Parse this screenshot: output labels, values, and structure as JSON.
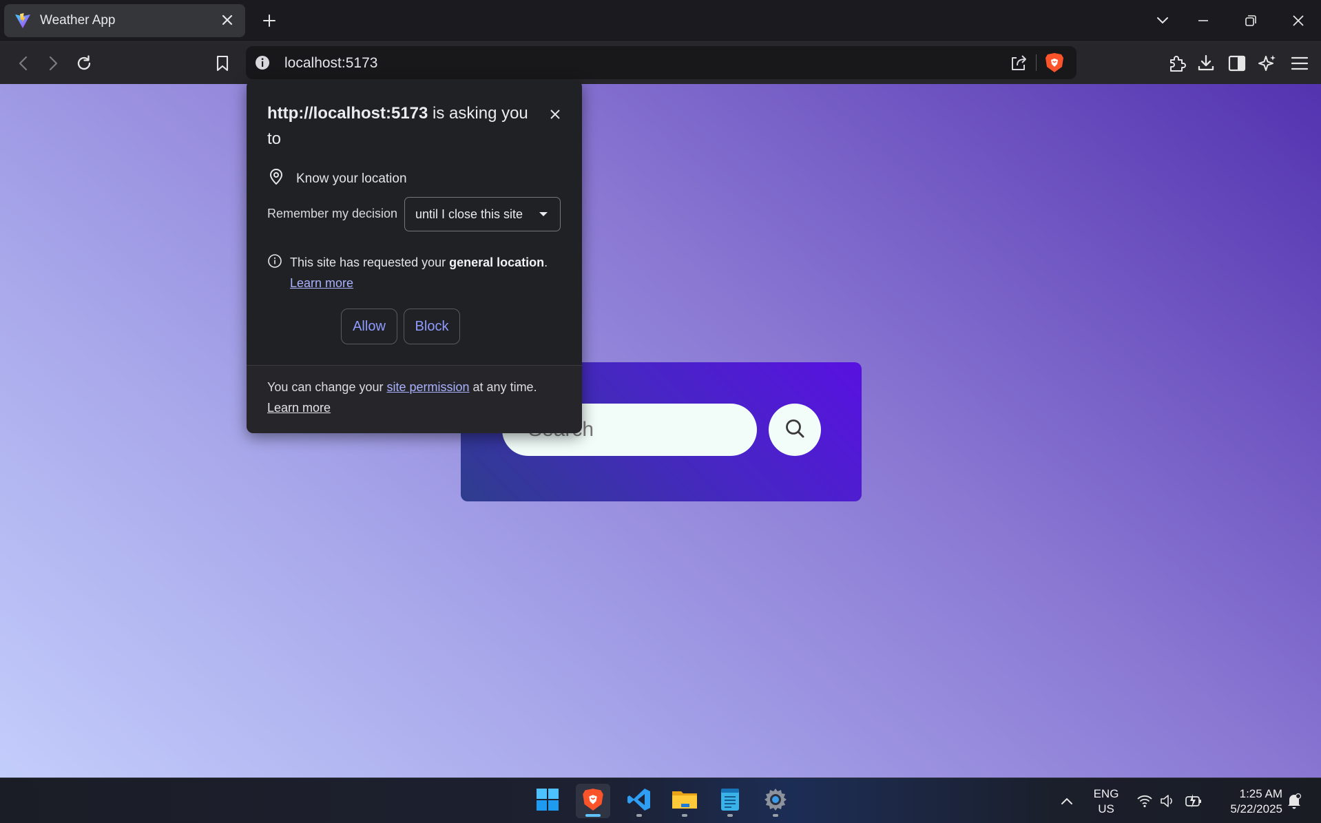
{
  "browser": {
    "tab": {
      "title": "Weather App",
      "favicon": "vite-logo-icon"
    },
    "window_controls": [
      "tab-search-icon",
      "minimize-icon",
      "restore-icon",
      "close-icon"
    ],
    "toolbar": {
      "url": "localhost:5173",
      "buttons": [
        "back-icon",
        "forward-icon",
        "reload-icon",
        "bookmark-icon"
      ],
      "right_icons": [
        "extensions-icon",
        "download-icon",
        "sidebar-icon",
        "leo-ai-icon",
        "menu-icon"
      ]
    }
  },
  "permission_prompt": {
    "origin": "http://localhost:5173",
    "title_suffix": " is asking you to",
    "permission": "Know your location",
    "remember_label": "Remember my decision",
    "remember_value": "until I close this site",
    "info_prefix": "This site has requested your ",
    "info_strong": "general location",
    "info_suffix": ".",
    "info_learn_more": "Learn more",
    "allow_label": "Allow",
    "block_label": "Block",
    "footer_prefix": "You can change your ",
    "footer_link": "site permission",
    "footer_suffix": " at any time.",
    "footer_learn_more": "Learn more"
  },
  "app": {
    "search_placeholder": "Search",
    "search_value": "",
    "search_button_icon": "search-icon"
  },
  "taskbar": {
    "apps": [
      {
        "name": "start",
        "icon": "windows-start-icon",
        "active": false
      },
      {
        "name": "brave",
        "icon": "brave-browser-icon",
        "active": true
      },
      {
        "name": "vscode",
        "icon": "vscode-icon",
        "active": false
      },
      {
        "name": "file-explorer",
        "icon": "folder-icon",
        "active": false
      },
      {
        "name": "notepad",
        "icon": "notepad-icon",
        "active": false
      },
      {
        "name": "settings",
        "icon": "settings-gear-icon",
        "active": false
      }
    ],
    "language_line1": "ENG",
    "language_line2": "US",
    "time": "1:25 AM",
    "date": "5/22/2025"
  },
  "colors": {
    "accent_link": "#aab1ff",
    "button_text": "#8f9bff",
    "card_gradient_start": "#2e3d8d",
    "card_gradient_end": "#5811e0",
    "brave_orange": "#fb542b"
  }
}
